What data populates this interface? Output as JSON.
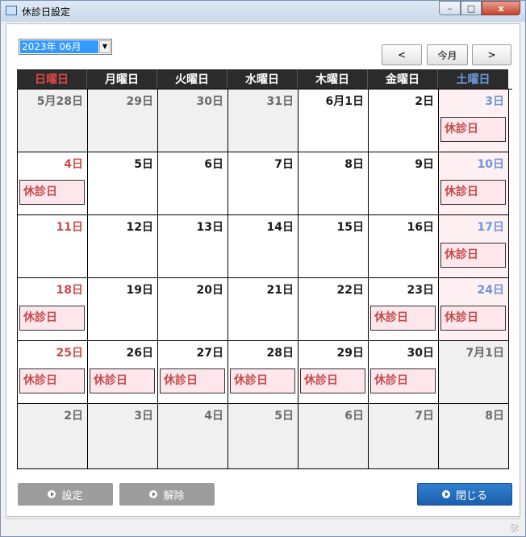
{
  "window": {
    "title": "休診日設定",
    "controls": {
      "minimize": "–",
      "maximize": "□",
      "close": "x"
    }
  },
  "toolbar": {
    "month_value": "2023年 06月",
    "prev_label": "<",
    "today_label": "今月",
    "next_label": ">"
  },
  "calendar": {
    "headers": [
      "日曜日",
      "月曜日",
      "火曜日",
      "水曜日",
      "木曜日",
      "金曜日",
      "土曜日"
    ],
    "badge_label": "休診日",
    "weeks": [
      [
        {
          "d": "5月28日",
          "other": true
        },
        {
          "d": "29日",
          "other": true
        },
        {
          "d": "30日",
          "other": true
        },
        {
          "d": "31日",
          "other": true
        },
        {
          "d": "6月1日"
        },
        {
          "d": "2日"
        },
        {
          "d": "3日",
          "off": true
        }
      ],
      [
        {
          "d": "4日",
          "off": true
        },
        {
          "d": "5日"
        },
        {
          "d": "6日"
        },
        {
          "d": "7日"
        },
        {
          "d": "8日"
        },
        {
          "d": "9日"
        },
        {
          "d": "10日",
          "off": true
        }
      ],
      [
        {
          "d": "11日"
        },
        {
          "d": "12日"
        },
        {
          "d": "13日"
        },
        {
          "d": "14日"
        },
        {
          "d": "15日"
        },
        {
          "d": "16日"
        },
        {
          "d": "17日",
          "off": true
        }
      ],
      [
        {
          "d": "18日",
          "off": true
        },
        {
          "d": "19日"
        },
        {
          "d": "20日"
        },
        {
          "d": "21日"
        },
        {
          "d": "22日"
        },
        {
          "d": "23日",
          "off": true
        },
        {
          "d": "24日",
          "off": true
        }
      ],
      [
        {
          "d": "25日",
          "off": true
        },
        {
          "d": "26日",
          "off": true
        },
        {
          "d": "27日",
          "off": true
        },
        {
          "d": "28日",
          "off": true
        },
        {
          "d": "29日",
          "off": true
        },
        {
          "d": "30日",
          "off": true
        },
        {
          "d": "7月1日",
          "other": true
        }
      ],
      [
        {
          "d": "2日",
          "other": true
        },
        {
          "d": "3日",
          "other": true
        },
        {
          "d": "4日",
          "other": true
        },
        {
          "d": "5日",
          "other": true
        },
        {
          "d": "6日",
          "other": true
        },
        {
          "d": "7日",
          "other": true
        },
        {
          "d": "8日",
          "other": true
        }
      ]
    ]
  },
  "footer": {
    "set_label": "設定",
    "clear_label": "解除",
    "close_label": "閉じる"
  },
  "colors": {
    "sunday": "#cc4b4b",
    "saturday": "#6b95dd",
    "badge_bg": "#fde7ec",
    "close_btn": "#1e5fae"
  }
}
